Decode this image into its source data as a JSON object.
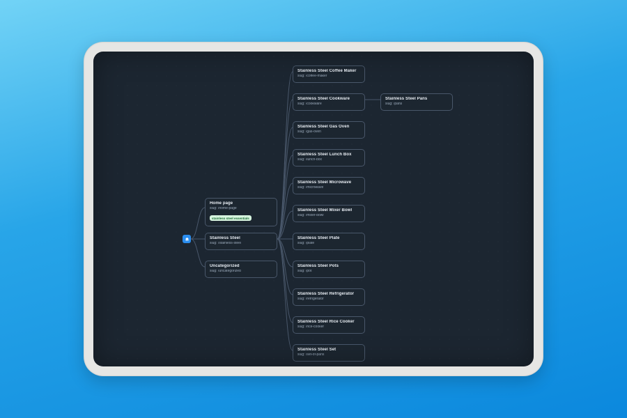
{
  "colors": {
    "bgGradStart": "#72d3f6",
    "bgGradEnd": "#0b88dd",
    "screen": "#1c2631",
    "nodeBorder": "#49576a",
    "accent": "#2a8def",
    "badgeBg": "#d7f5df",
    "badgeText": "#1b6a33"
  },
  "root": {
    "icon": "home-icon"
  },
  "col1": [
    {
      "title": "Home page",
      "slug": "slug: /home-page",
      "badge": "stainless steel essentials"
    },
    {
      "title": "Stainless Steel",
      "slug": "slug: /stainless-steel"
    },
    {
      "title": "Uncategorized",
      "slug": "slug: /uncategorized"
    }
  ],
  "col2": [
    {
      "title": "Stainless Steel Coffee Maker",
      "slug": "slug: /coffee-maker"
    },
    {
      "title": "Stainless Steel Cookware",
      "slug": "slug: /cookware"
    },
    {
      "title": "Stainless Steel Gas Oven",
      "slug": "slug: /gas-oven"
    },
    {
      "title": "Stainless Steel Lunch Box",
      "slug": "slug: /lunch-box"
    },
    {
      "title": "Stainless Steel Microwave",
      "slug": "slug: /microwave"
    },
    {
      "title": "Stainless Steel Mixer Bowl",
      "slug": "slug: /mixer-bowl"
    },
    {
      "title": "Stainless Steel Plate",
      "slug": "slug: /plate"
    },
    {
      "title": "Stainless Steel Pots",
      "slug": "slug: /pot"
    },
    {
      "title": "Stainless Steel Refrigerator",
      "slug": "slug: /refrigerator"
    },
    {
      "title": "Stainless Steel Rice Cooker",
      "slug": "slug: /rice-cooker"
    },
    {
      "title": "Stainless Steel Set",
      "slug": "slug: /set-of-pans"
    }
  ],
  "col3": [
    {
      "title": "Stainless Steel Pans",
      "slug": "slug: /pans"
    }
  ]
}
